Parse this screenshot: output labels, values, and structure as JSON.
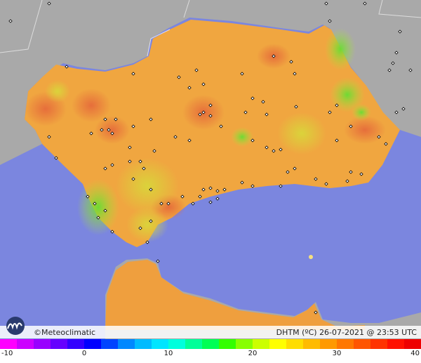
{
  "brand": {
    "copyright": "©Meteoclimatic"
  },
  "caption": {
    "variable": "DHTM (ºC)",
    "datetime": "26-07-2021 @ 23:53 UTC"
  },
  "scale": {
    "ticks": [
      "-10",
      "0",
      "10",
      "20",
      "30",
      "40"
    ],
    "min": -10,
    "max": 40,
    "colors": [
      "#ff00ff",
      "#cc00ff",
      "#9900ff",
      "#6600ff",
      "#3300ff",
      "#0000ff",
      "#0044ff",
      "#0088ff",
      "#00bbff",
      "#00e5ff",
      "#00ffdd",
      "#00ff99",
      "#00ff55",
      "#33ff00",
      "#88ff00",
      "#ccff00",
      "#ffff00",
      "#ffdd00",
      "#ffbb00",
      "#ff9900",
      "#ff7700",
      "#ff5500",
      "#ff3300",
      "#ff1100",
      "#ee0000"
    ]
  },
  "colors": {
    "sea": "#7b86df",
    "land_outside": "#a9a9a9",
    "land_base": "#f0a640"
  }
}
